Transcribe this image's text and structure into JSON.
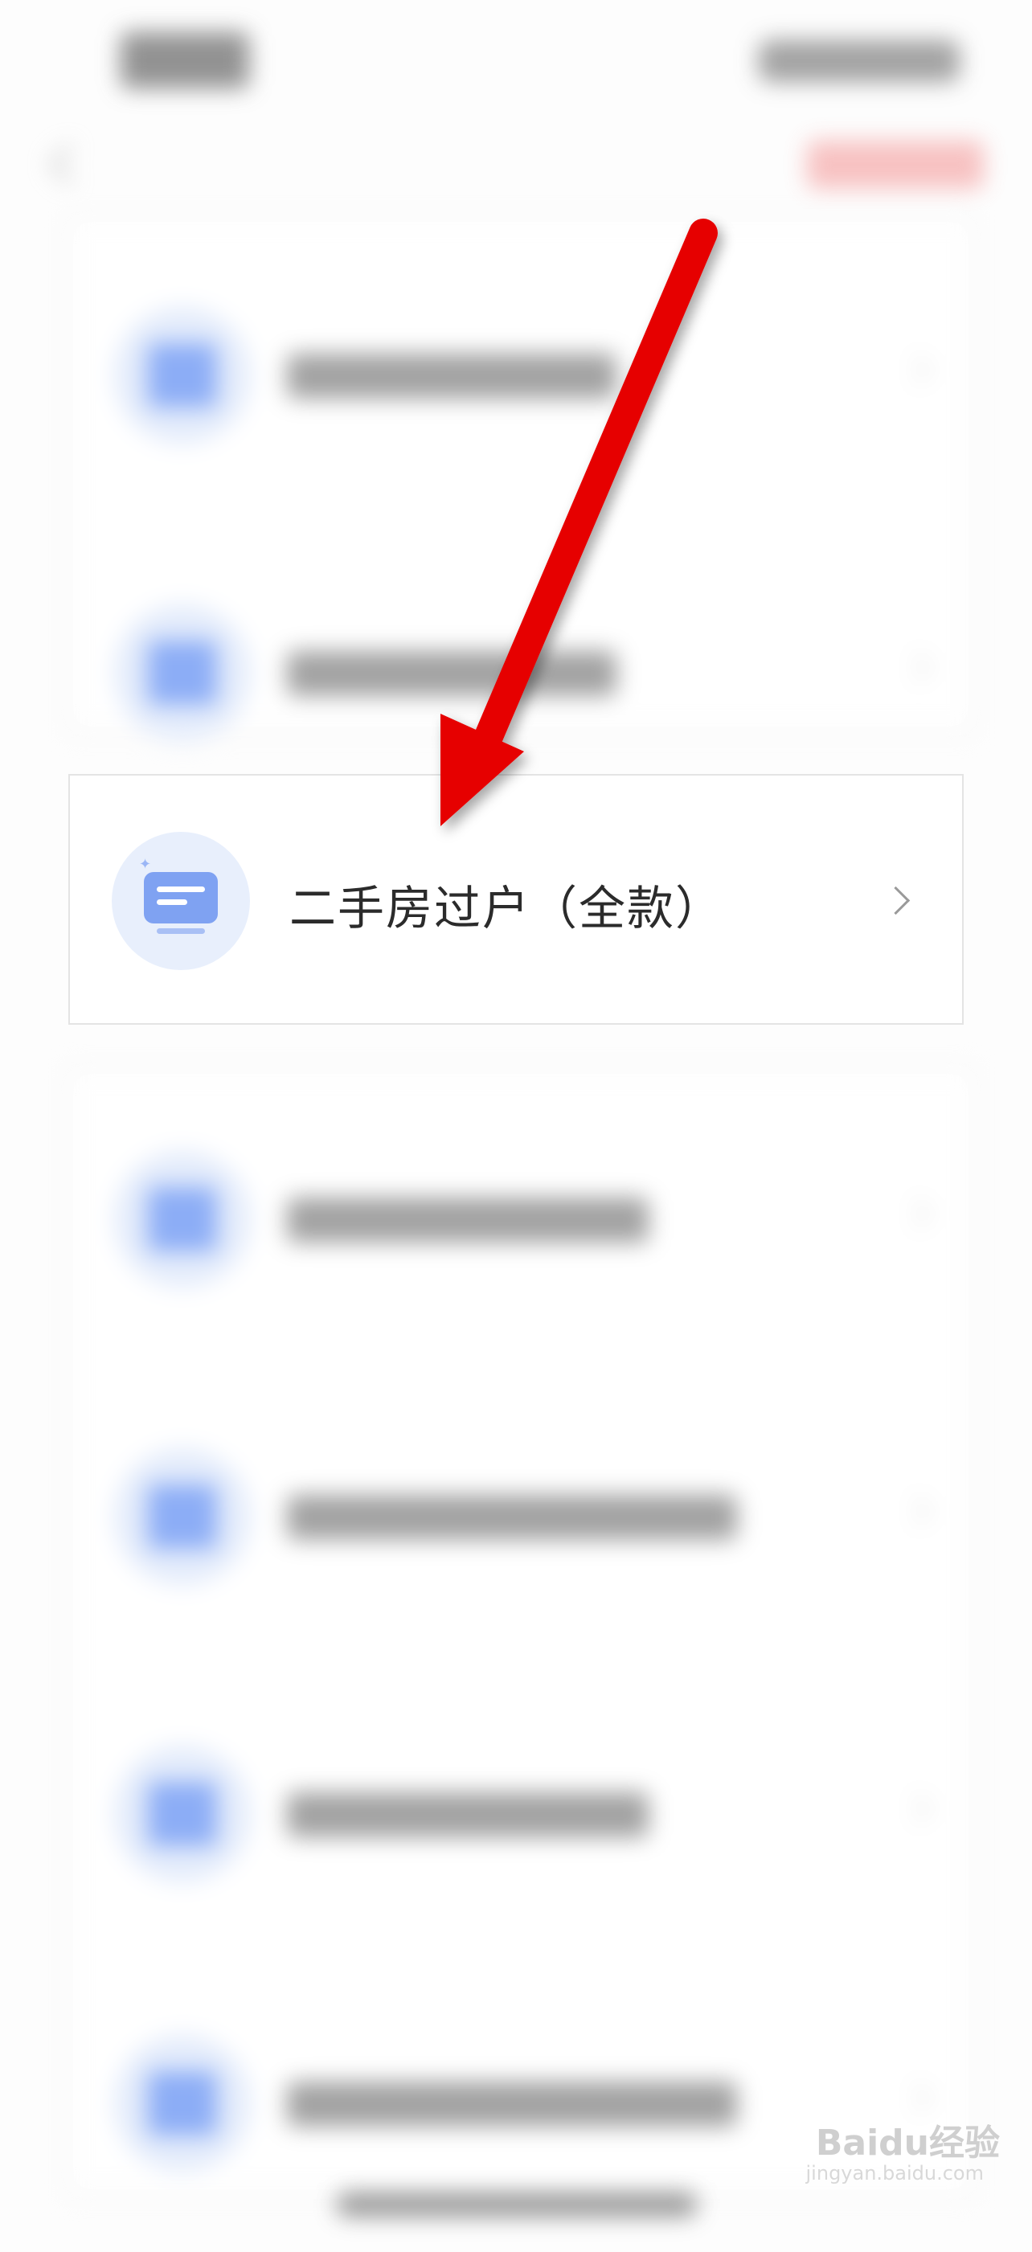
{
  "focus_item": {
    "label": "二手房过户（全款）"
  },
  "watermark": {
    "text": "Baidu经验",
    "sub": "jingyan.baidu.com"
  },
  "colors": {
    "accent_blue": "#7fa2f2",
    "arrow_red": "#e60000"
  },
  "icons": {
    "focus_item_icon": "document-monitor-icon",
    "chevron": "chevron-right-icon"
  }
}
